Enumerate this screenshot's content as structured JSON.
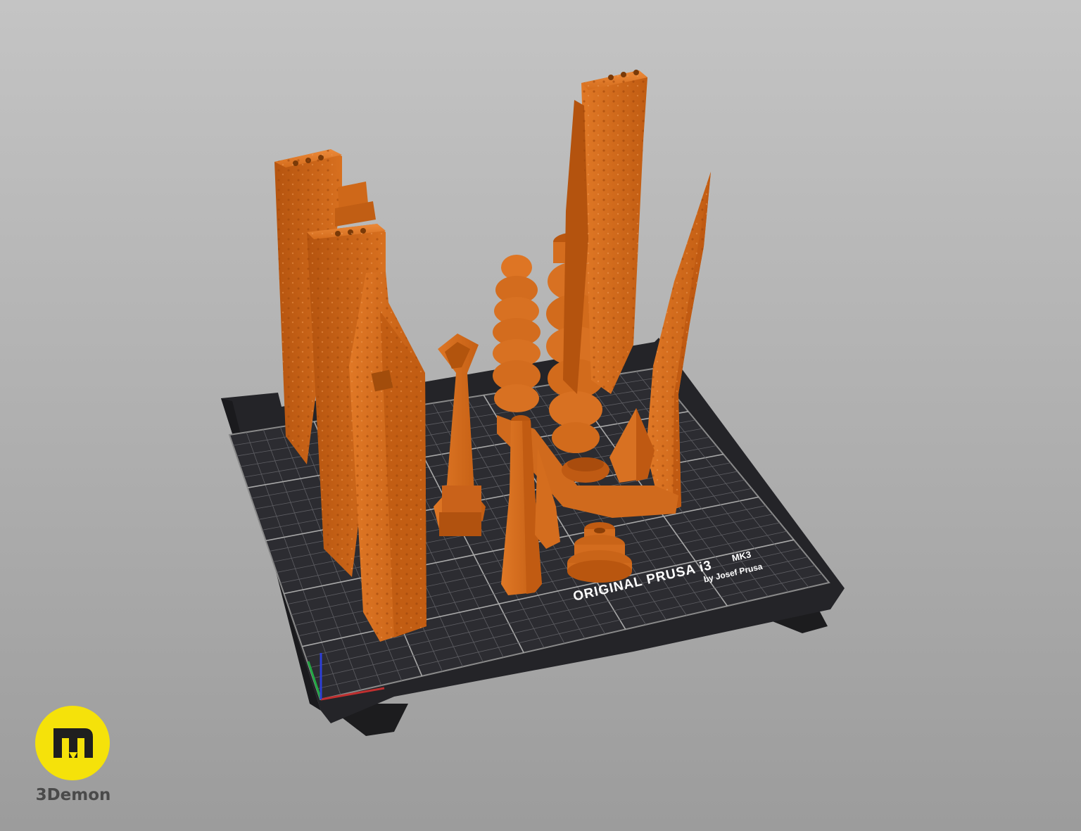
{
  "scene": {
    "background_top": "#c4c4c4",
    "background_bottom": "#9c9c9c",
    "model_color": "#d56a1b",
    "bed_color": "#2a2a2e",
    "grid_color": "#707070"
  },
  "bed": {
    "label_main": "ORIGINAL PRUSA i3",
    "label_model": "MK3",
    "label_sub": "by Josef Prusa"
  },
  "axes": {
    "x_color": "#c03030",
    "y_color": "#22aa44",
    "z_color": "#2d3fd8"
  },
  "brand": {
    "name": "3Demon",
    "accent": "#f5e20a"
  }
}
